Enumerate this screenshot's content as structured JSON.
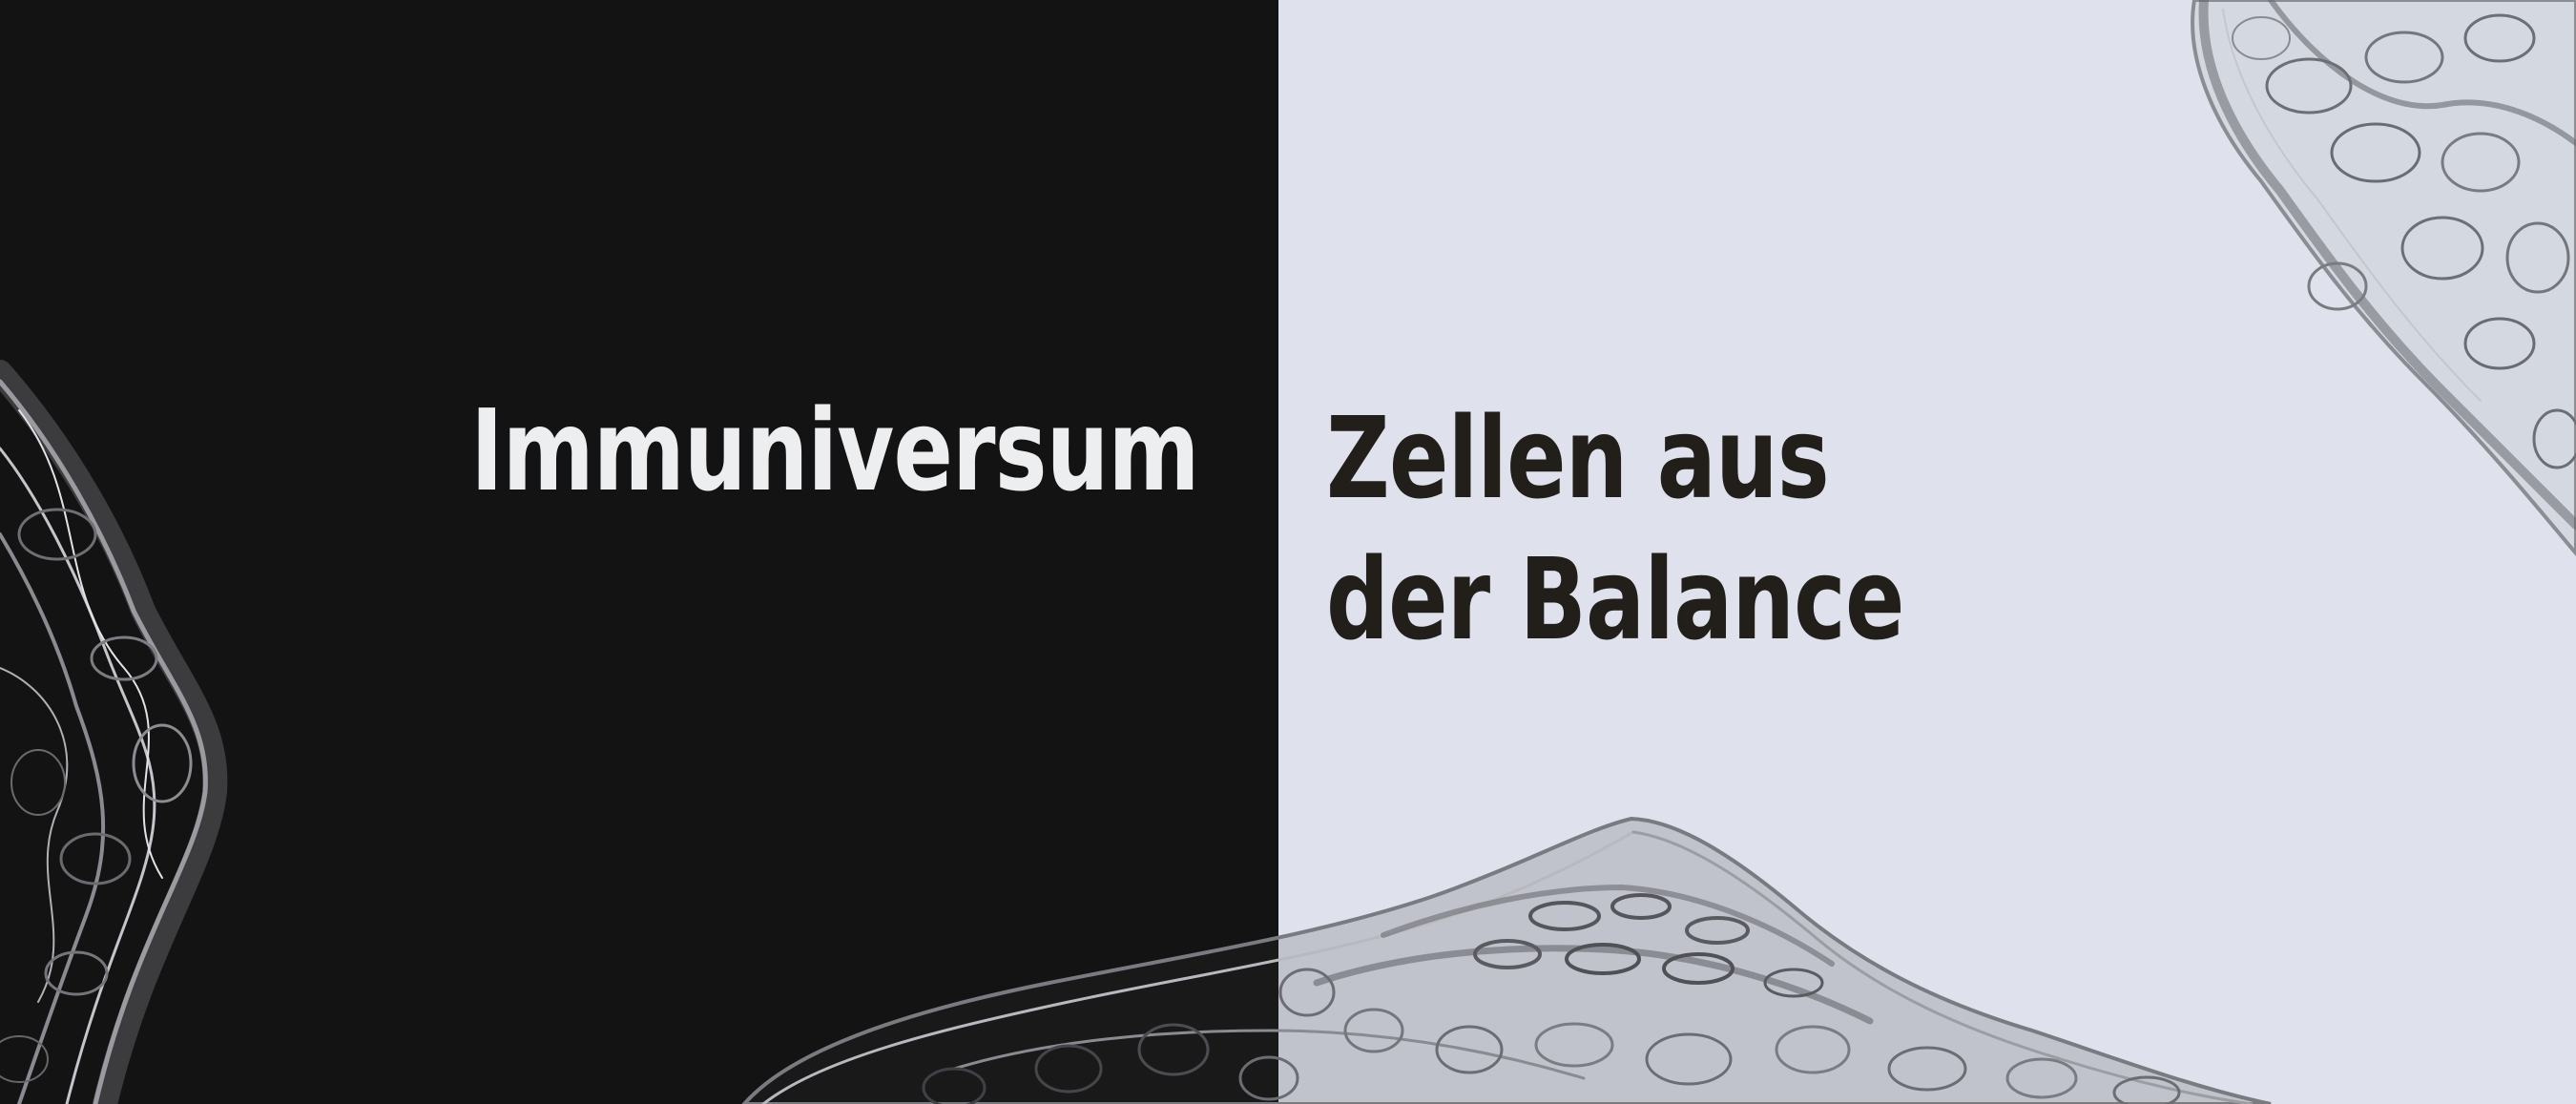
{
  "banner": {
    "left_title": "Immuniversum",
    "right_title_line1": "Zellen aus",
    "right_title_line2": "der Balance"
  },
  "colors": {
    "dark_panel": "#141313",
    "light_panel": "#dfe2ec",
    "left_text": "#eceef0",
    "right_text": "#221f1a"
  },
  "decoration": {
    "left_sculpture": "wireframe-cell-sculpture",
    "bottom_sculpture": "wireframe-cell-sculpture",
    "top_right_sculpture": "wireframe-cell-sculpture"
  }
}
